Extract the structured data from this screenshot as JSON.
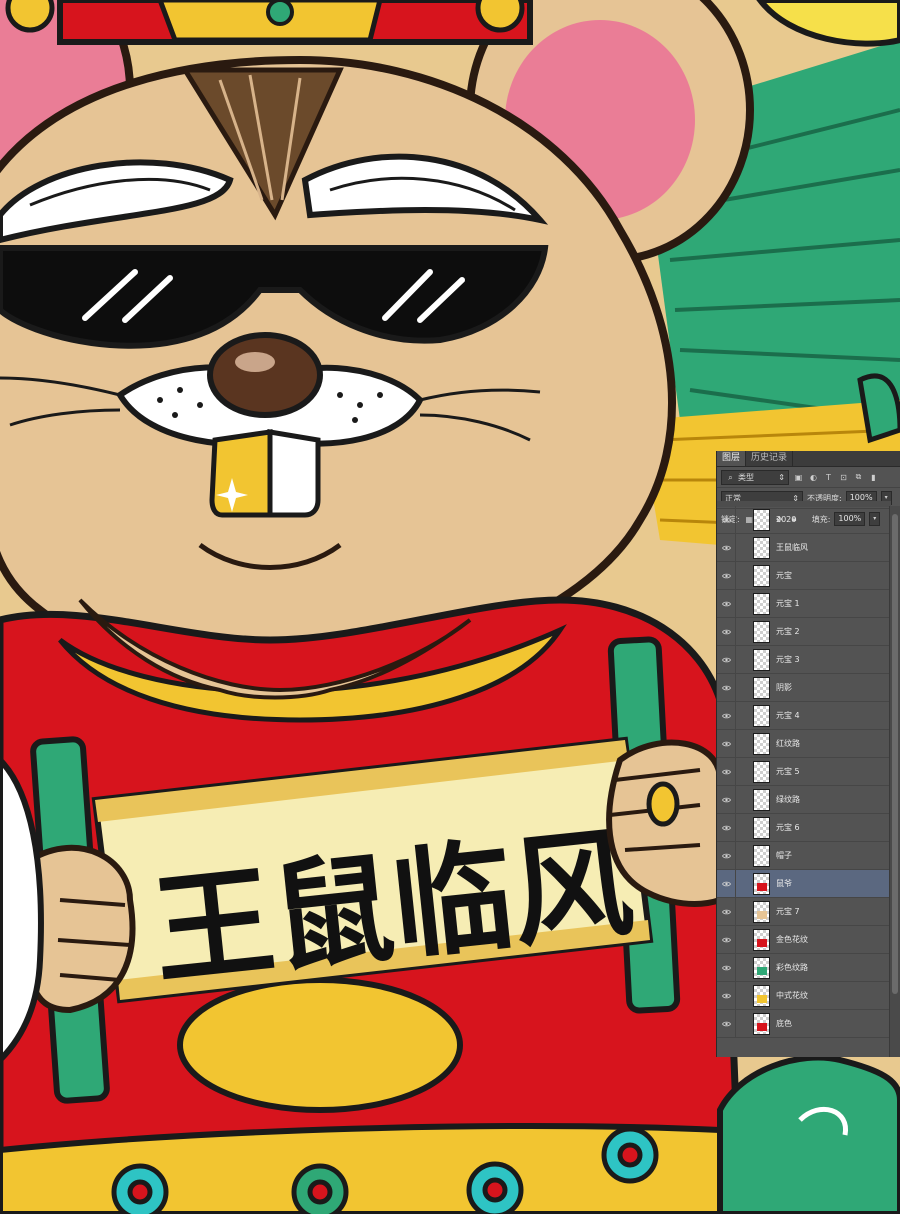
{
  "colors": {
    "panel_bg": "#535353",
    "selected_row": "#5b6880",
    "art_red": "#d7141d",
    "art_green": "#2fa876",
    "art_fur": "#e6c495",
    "art_gold": "#f2c531",
    "scroll_paper": "#f6edb4"
  },
  "artwork": {
    "scroll_text": "王鼠临风"
  },
  "layers_panel": {
    "tabs": [
      {
        "label": "图层"
      },
      {
        "label": "历史记录"
      }
    ],
    "filter": {
      "label": "类型",
      "icon": "search-icon"
    },
    "blend_mode": "正常",
    "opacity_label": "不透明度:",
    "opacity_value": "100%",
    "lock_label": "锁定:",
    "fill_label": "填充:",
    "fill_value": "100%",
    "layers": [
      {
        "name": "2020"
      },
      {
        "name": "王鼠临风"
      },
      {
        "name": "元宝"
      },
      {
        "name": "元宝 1"
      },
      {
        "name": "元宝 2"
      },
      {
        "name": "元宝 3"
      },
      {
        "name": "阴影"
      },
      {
        "name": "元宝 4"
      },
      {
        "name": "红纹路"
      },
      {
        "name": "元宝 5"
      },
      {
        "name": "绿纹路"
      },
      {
        "name": "元宝 6"
      },
      {
        "name": "帽子"
      },
      {
        "name": "鼠爷",
        "selected": true
      },
      {
        "name": "元宝 7"
      },
      {
        "name": "金色花纹"
      },
      {
        "name": "彩色纹路"
      },
      {
        "name": "中式花纹"
      },
      {
        "name": "底色"
      }
    ]
  }
}
